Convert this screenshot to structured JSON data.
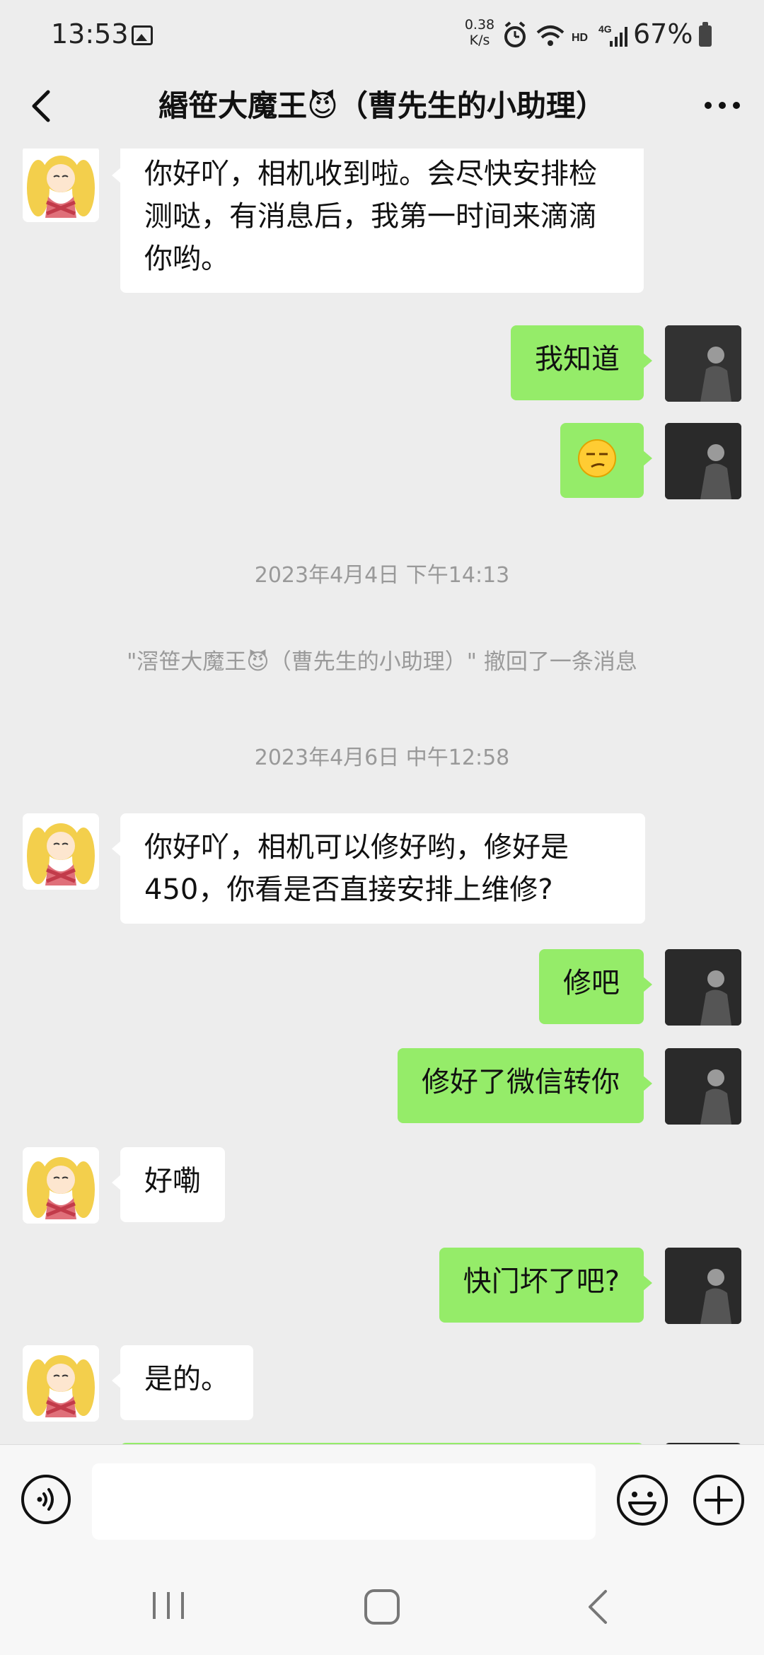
{
  "status_bar": {
    "time": "13:53",
    "speed": "0.38",
    "speed_unit": "K/s",
    "hd_label": "HD",
    "network_label": "4G",
    "battery": "67%"
  },
  "header": {
    "title": "緡笹大魔王😈（曹先生的小助理）"
  },
  "messages": [
    {
      "text": "你好吖，相机收到啦。会尽快安排检测哒，有消息后，我第一时间来滴滴你哟。"
    },
    {
      "text": "我知道"
    },
    {
      "text": "😏"
    },
    {
      "text": "2023年4月4日 下午14:13"
    },
    {
      "text": "\"滘笹大魔王😈（曹先生的小助理）\" 撤回了一条消息"
    },
    {
      "text": "2023年4月6日 中午12:58"
    },
    {
      "text": "你好吖，相机可以修好哟，修好是450，你看是否直接安排上维修?"
    },
    {
      "text": "修吧"
    },
    {
      "text": "修好了微信转你"
    },
    {
      "text": "好嘞"
    },
    {
      "text": "快门坏了吧?"
    },
    {
      "text": "是的。"
    }
  ],
  "input_bar": {
    "placeholder": ""
  },
  "colors": {
    "background": "#ededed",
    "outgoing_bubble": "#95ec69",
    "incoming_bubble": "#ffffff",
    "timestamp_text": "#999999"
  }
}
